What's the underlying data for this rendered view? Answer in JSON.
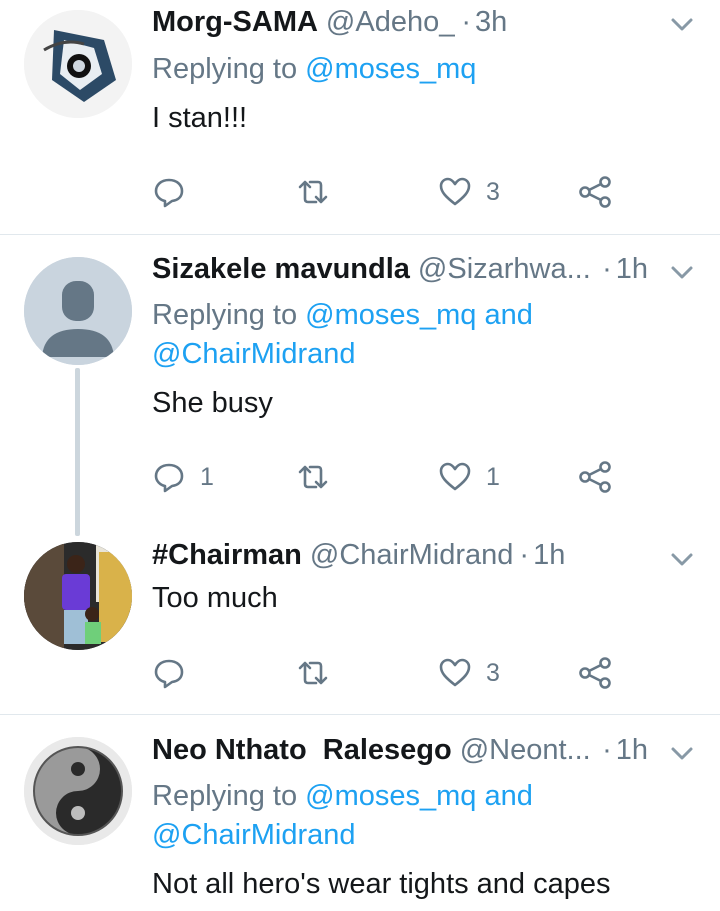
{
  "colors": {
    "link": "#1da1f2",
    "muted": "#657786",
    "divider": "#e1e8ed"
  },
  "tweets": [
    {
      "name": "Morg-SAMA",
      "handle": "@Adeho_",
      "dot": "·",
      "time": "3h",
      "reply_prefix": "Replying to",
      "reply_to": "@moses_mq",
      "text": "I stan!!!",
      "reply_count": "",
      "retweet_count": "",
      "like_count": "3"
    },
    {
      "name": "Sizakele mavundla",
      "handle": "@Sizarhwa...",
      "dot": "·",
      "time": "1h",
      "reply_prefix": "Replying to",
      "reply_to": "@moses_mq and",
      "reply_to_2": "@ChairMidrand",
      "text": "She busy",
      "reply_count": "1",
      "retweet_count": "",
      "like_count": "1"
    },
    {
      "name": "#Chairman",
      "handle": "@ChairMidrand",
      "dot": "·",
      "time": "1h",
      "text": "Too much",
      "reply_count": "",
      "retweet_count": "",
      "like_count": "3"
    },
    {
      "name": "Neo Nthato  Ralesego",
      "handle": "@Neont...",
      "dot": "·",
      "time": "1h",
      "reply_prefix": "Replying to",
      "reply_to": "@moses_mq and",
      "reply_to_2": "@ChairMidrand",
      "text": "Not all hero's wear tights and capes"
    }
  ],
  "icons": {
    "caret": "chevron-down-icon",
    "reply": "reply-icon",
    "retweet": "retweet-icon",
    "like": "heart-icon",
    "share": "share-icon"
  }
}
